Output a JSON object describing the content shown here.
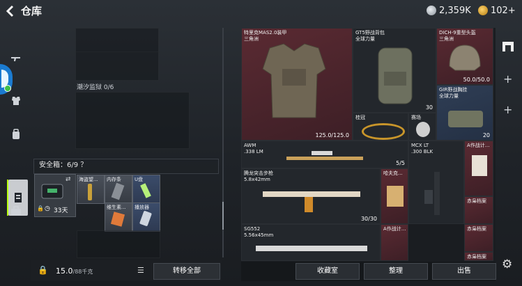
{
  "header": {
    "back_icon": "arrow-left",
    "title": "仓库",
    "currency_silver": "2,359K",
    "currency_gold": "102+",
    "silver_color": "#bfc5cc",
    "gold_color": "#f0b02a"
  },
  "sidenav": {
    "items": [
      {
        "name": "gun-icon"
      },
      {
        "name": "armor-icon"
      },
      {
        "name": "backpack-icon"
      },
      {
        "name": "stash-icon"
      },
      {
        "name": "briefcase-icon"
      }
    ],
    "active_color": "#b6ff00"
  },
  "storage": {
    "container_label": "潮汐监狱 0/6",
    "safe_label": "安全箱：6/9 ？",
    "safe_days": "33天",
    "safe_items": [
      {
        "label": "海盗望..."
      },
      {
        "label": "内存条"
      },
      {
        "label": "U盘"
      },
      {
        "label": "维生素..."
      },
      {
        "label": "播放器"
      }
    ],
    "weight": "15.0",
    "weight_max": "/88千克",
    "transfer_all": "转移全部"
  },
  "grid": {
    "tiles": [
      {
        "label": "特里克MAS2.0装甲\n三角洲",
        "value": "125.0/125.0"
      },
      {
        "label": "GT5野战背包\n全球力量",
        "value": "30"
      },
      {
        "label": "DICH-9重型头盔\n三角洲",
        "value": "50.0/50.0"
      },
      {
        "label": "GIR野战胸挂\n全球力量",
        "value": "20"
      },
      {
        "label": "桂冠",
        "value": ""
      },
      {
        "label": "赛场",
        "value": ""
      },
      {
        "label": "AWM\n.338 LM",
        "value": "5/5"
      },
      {
        "label": "MCX LT\n.300 BLK",
        "value": ""
      },
      {
        "label": "A作战计...",
        "value": ""
      },
      {
        "label": "腾龙突击步枪\n5.8x42mm",
        "value": "30/30"
      },
      {
        "label": "哈夫克...",
        "value": ""
      },
      {
        "label": "赤枭档案",
        "value": ""
      },
      {
        "label": "赤枭档案",
        "value": ""
      },
      {
        "label": "SG552\n5.56x45mm",
        "value": ""
      },
      {
        "label": "A作战计...",
        "value": ""
      },
      {
        "label": "赤枭档案",
        "value": ""
      }
    ]
  },
  "bottom_buttons": {
    "collection": "收藏室",
    "organize": "整理",
    "sell": "出售"
  },
  "rightnav": {
    "items": [
      {
        "name": "home-icon"
      },
      {
        "name": "plus-icon"
      },
      {
        "name": "plus-icon"
      },
      {
        "name": "settings-icon"
      }
    ]
  }
}
